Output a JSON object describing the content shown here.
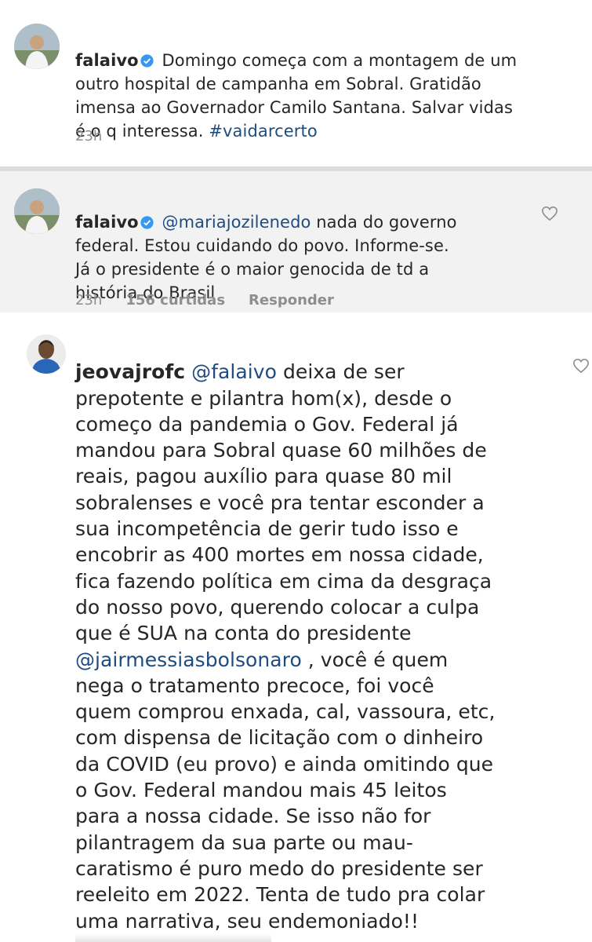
{
  "comments": [
    {
      "username": "falaivo",
      "verified": true,
      "text_before": " Domingo começa com a montagem de um\noutro hospital de campanha em Sobral. Gratidão\nimensa ao Governador Camilo Santana. Salvar vidas\né o q interessa. ",
      "hashtag": "#vaidarcerto",
      "time": "23h"
    },
    {
      "username": "falaivo",
      "verified": true,
      "mention": "@mariajozilenedo",
      "text_after": " nada do governo\nfederal. Estou cuidando do povo. Informe-se.\nJá o presidente é o maior genocida de td a\nhistória do Brasil",
      "time": "23h",
      "likes": "156 curtidas",
      "reply_label": "Responder"
    },
    {
      "username": "jeovajrofc",
      "verified": false,
      "mention1": "@falaivo",
      "text_part1": " deixa de ser\nprepotente e pilantra hom(x), desde o\ncomeço da pandemia o Gov. Federal já\nmandou para Sobral quase 60 milhões de\nreais, pagou auxílio para quase 80 mil\nsobralenses e você pra tentar esconder a\nsua incompetência de gerir tudo isso e\nencobrir as 400 mortes em nossa cidade,\nfica fazendo política em cima da desgraça\ndo nosso povo, querendo colocar a culpa\nque é SUA na conta do presidente\n",
      "mention2": "@jairmessiasbolsonaro",
      "text_part2": " , você é quem\nnega o tratamento precoce, foi você\nquem comprou enxada, cal, vassoura, etc,\ncom dispensa de licitação com o dinheiro\nda COVID (eu provo) e ainda omitindo que\no Gov. Federal mandou mais 45 leitos\npara a nossa cidade. Se isso não for\npilantragem da sua parte ou mau-\ncaratismo é puro medo do presidente ser\nreeleito em 2022. Tenta de tudo pra colar\numa narrativa, seu endemoniado!!"
    }
  ],
  "colors": {
    "link": "#1f4c80",
    "meta": "#8e8e8e",
    "verified_badge": "#3897f0"
  },
  "icons": [
    "verified-badge-icon",
    "heart-icon"
  ]
}
